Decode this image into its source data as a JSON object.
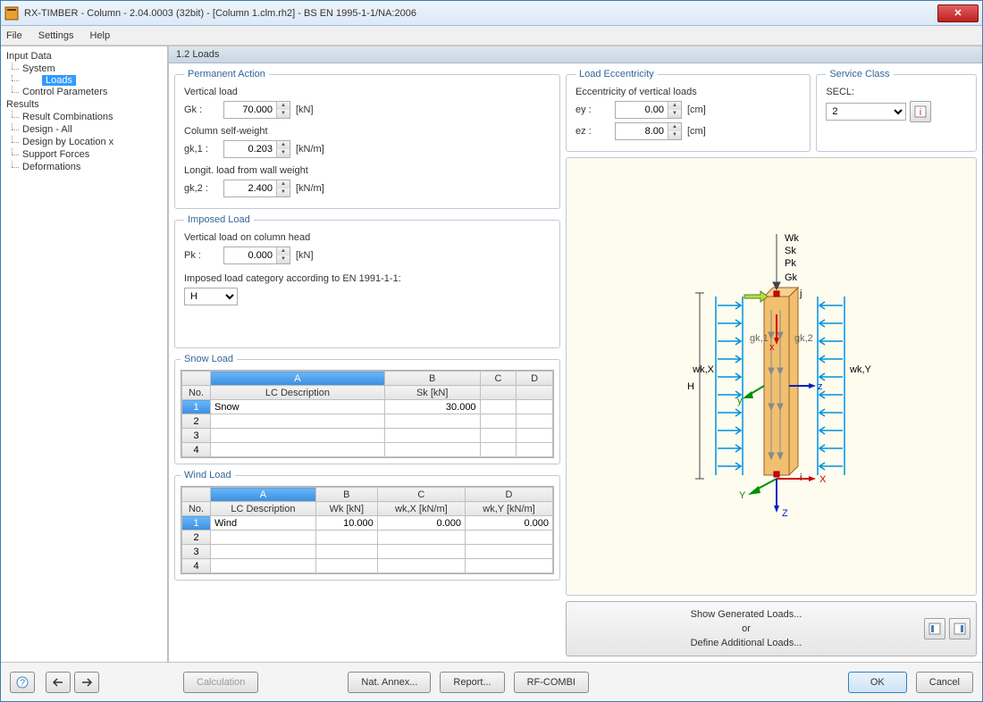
{
  "window": {
    "title": "RX-TIMBER - Column - 2.04.0003 (32bit) - [Column 1.clm.rh2] - BS EN 1995-1-1/NA:2006"
  },
  "menu": {
    "file": "File",
    "settings": "Settings",
    "help": "Help"
  },
  "tree": {
    "input": "Input Data",
    "system": "System",
    "loads": "Loads",
    "control": "Control Parameters",
    "results": "Results",
    "resultcomb": "Result Combinations",
    "designall": "Design - All",
    "designloc": "Design by Location x",
    "support": "Support Forces",
    "deform": "Deformations"
  },
  "page": {
    "title": "1.2 Loads"
  },
  "perm": {
    "legend": "Permanent Action",
    "vload_lbl": "Vertical load",
    "gk_sym": "Gk :",
    "gk_val": "70.000",
    "gk_unit": "[kN]",
    "csw_lbl": "Column self-weight",
    "gk1_sym": "gk,1 :",
    "gk1_val": "0.203",
    "gk1_unit": "[kN/m]",
    "lw_lbl": "Longit. load from wall weight",
    "gk2_sym": "gk,2 :",
    "gk2_val": "2.400",
    "gk2_unit": "[kN/m]"
  },
  "imp": {
    "legend": "Imposed Load",
    "vlh_lbl": "Vertical load on column head",
    "pk_sym": "Pk :",
    "pk_val": "0.000",
    "pk_unit": "[kN]",
    "cat_lbl": "Imposed load category according to EN 1991-1-1:",
    "cat_val": "H"
  },
  "snow": {
    "legend": "Snow Load",
    "colA": "A",
    "colB": "B",
    "colC": "C",
    "colD": "D",
    "no": "No.",
    "desc": "LC Description",
    "sk": "Sk [kN]",
    "r1_desc": "Snow",
    "r1_sk": "30.000"
  },
  "wind": {
    "legend": "Wind Load",
    "colA": "A",
    "colB": "B",
    "colC": "C",
    "colD": "D",
    "no": "No.",
    "desc": "LC Description",
    "wk": "Wk [kN]",
    "wkx": "wk,X [kN/m]",
    "wky": "wk,Y [kN/m]",
    "r1_desc": "Wind",
    "r1_wk": "10.000",
    "r1_wkx": "0.000",
    "r1_wky": "0.000"
  },
  "ecc": {
    "legend": "Load Eccentricity",
    "lbl": "Eccentricity of vertical loads",
    "ey_sym": "ey :",
    "ey_val": "0.00",
    "ey_unit": "[cm]",
    "ez_sym": "ez :",
    "ez_val": "8.00",
    "ez_unit": "[cm]"
  },
  "svc": {
    "legend": "Service Class",
    "lbl": "SECL:",
    "val": "2"
  },
  "diag": {
    "H": "H",
    "Wk": "Wk",
    "Sk": "Sk",
    "Pk": "Pk",
    "Gk": "Gk",
    "gk1": "gk,1",
    "gk2": "gk,2",
    "wkX": "wk,X",
    "wkY": "wk,Y",
    "j": "j",
    "i": "i",
    "x": "x",
    "y": "y",
    "z": "z",
    "X": "X",
    "Y": "Y",
    "Z": "Z"
  },
  "gen": {
    "show": "Show Generated Loads...",
    "or": "or",
    "def": "Define Additional Loads..."
  },
  "footer": {
    "calc": "Calculation",
    "annex": "Nat. Annex...",
    "report": "Report...",
    "rfcombi": "RF-COMBI",
    "ok": "OK",
    "cancel": "Cancel"
  }
}
